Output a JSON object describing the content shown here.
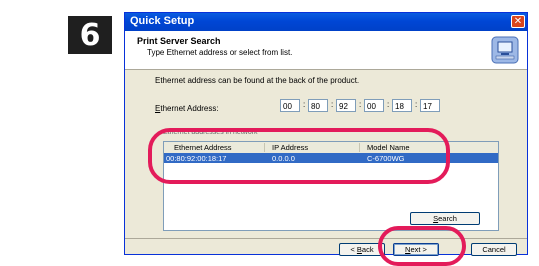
{
  "step": "6",
  "window": {
    "title": "Quick Setup",
    "close_glyph": "✕"
  },
  "header": {
    "title": "Print Server Search",
    "subtitle": "Type Ethernet address or select from list."
  },
  "hint": "Ethernet address can be found at the back of the product.",
  "address": {
    "label_mnemonic": "E",
    "label_rest": "thernet Address:",
    "octets": [
      "00",
      "80",
      "92",
      "00",
      "18",
      "17"
    ],
    "separator": ":"
  },
  "list": {
    "caption": "Ethernet addresses in network",
    "columns": [
      "Ethernet Address",
      "IP Address",
      "Model Name"
    ],
    "rows": [
      {
        "mac": "00:80:92:00:18:17",
        "ip": "0.0.0.0",
        "model": "C-6700WG"
      }
    ]
  },
  "buttons": {
    "search_mnemonic": "S",
    "search_rest": "earch",
    "back_prefix": "< ",
    "back_mnemonic": "B",
    "back_rest": "ack",
    "next_mnemonic": "N",
    "next_rest": "ext >",
    "cancel": "Cancel"
  },
  "icons": [
    "close-icon",
    "computer-icon"
  ],
  "colors": {
    "title_bar": "#0a5ce0",
    "selection": "#316ac5",
    "highlight_ring": "#e31b5a"
  }
}
